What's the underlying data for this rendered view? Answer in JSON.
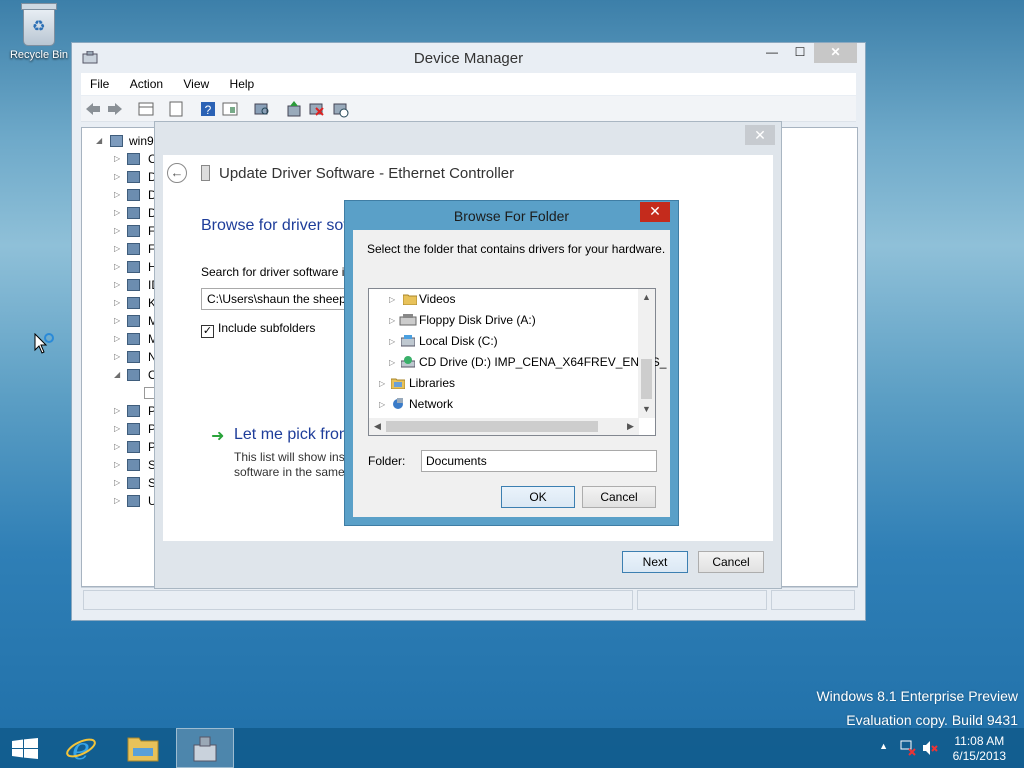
{
  "desktop": {
    "recycle_bin_label": "Recycle Bin",
    "watermark_line1": "Windows 8.1 Enterprise Preview",
    "watermark_line2": "Evaluation copy. Build 9431"
  },
  "device_manager": {
    "title": "Device Manager",
    "menu": [
      "File",
      "Action",
      "View",
      "Help"
    ],
    "tree_root": "win9",
    "tree_items": [
      "C",
      "D",
      "D",
      "D",
      "F",
      "F",
      "H",
      "ID",
      "K",
      "M",
      "M",
      "N",
      "O",
      "",
      "P",
      "P",
      "P",
      "S",
      "S",
      "U"
    ]
  },
  "update_driver": {
    "title": "Update Driver Software - Ethernet Controller",
    "heading": "Browse for driver sof",
    "search_label": "Search for driver software in",
    "path_value": "C:\\Users\\shaun the sheep\\",
    "include_subfolders": "Include subfolders",
    "pick_heading": "Let me pick from",
    "pick_desc_line1": "This list will show inst",
    "pick_desc_line2": "software in the same",
    "next_label": "Next",
    "cancel_label": "Cancel"
  },
  "browse_folder": {
    "title": "Browse For Folder",
    "prompt": "Select the folder that contains drivers for your hardware.",
    "items": [
      {
        "label": "Videos",
        "icon": "folder-icon"
      },
      {
        "label": "Floppy Disk Drive (A:)",
        "icon": "floppy-icon"
      },
      {
        "label": "Local Disk (C:)",
        "icon": "disk-icon"
      },
      {
        "label": "CD Drive (D:) IMP_CENA_X64FREV_EN-US_",
        "icon": "cd-icon"
      },
      {
        "label": "Libraries",
        "icon": "libraries-icon"
      },
      {
        "label": "Network",
        "icon": "network-icon"
      }
    ],
    "folder_label": "Folder:",
    "folder_value": "Documents",
    "ok_label": "OK",
    "cancel_label": "Cancel"
  },
  "taskbar": {
    "time": "11:08 AM",
    "date": "6/15/2013"
  }
}
